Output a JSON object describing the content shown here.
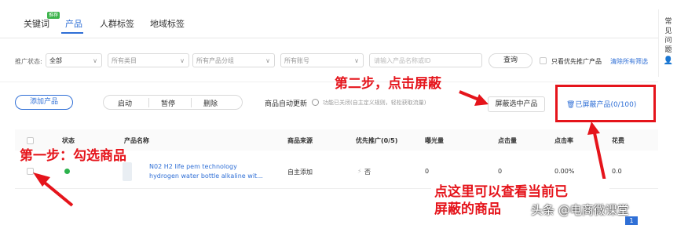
{
  "tabs": [
    {
      "label": "关键词"
    },
    {
      "label": "产品"
    },
    {
      "label": "人群标签"
    },
    {
      "label": "地域标签"
    }
  ],
  "tab_badge": "推荐",
  "filters": {
    "status_label": "推广状态:",
    "status_value": "全部",
    "category": "所有类目",
    "product_group": "所有产品分组",
    "account": "所有账号",
    "search_placeholder": "请输入产品名称或ID",
    "query_button": "查询",
    "only_priority": "只看优先推广产品",
    "clear_filters": "清除所有筛选"
  },
  "actions": {
    "add_product": "添加产品",
    "start": "启动",
    "pause": "暂停",
    "delete": "删除",
    "auto_update_label": "商品自动更新",
    "auto_update_hint": "功能已关闭(自主定义规则，轻松获取流量)",
    "block_selected": "屏蔽选中产品",
    "blocked_products": "已屏蔽产品(0/100)"
  },
  "table": {
    "headers": [
      "状态",
      "产品名称",
      "商品来源",
      "优先推广(0/5)",
      "曝光量",
      "点击量",
      "点击率",
      "花费"
    ],
    "rows": [
      {
        "name_line1": "N02 H2 life pem technology",
        "name_line2": "hydrogen water bottle alkaline wit...",
        "source": "自主添加",
        "priority": "否",
        "impressions": "0",
        "clicks": "0",
        "ctr": "0.00%",
        "cost": "0.0"
      }
    ]
  },
  "annotations": {
    "step1": "第一步：勾选商品",
    "step2": "第二步，点击屏蔽",
    "note_line1": "点这里可以查看当前已",
    "note_line2": "屏蔽的商品"
  },
  "help": {
    "line1": "常",
    "line2": "见",
    "line3": "问",
    "line4": "题"
  },
  "watermark": "头条 @电商微课堂",
  "pagination": {
    "current": "1"
  },
  "colors": {
    "accent": "#2f6fd6",
    "annotation": "#e5141b",
    "status_green": "#2bb24c"
  }
}
